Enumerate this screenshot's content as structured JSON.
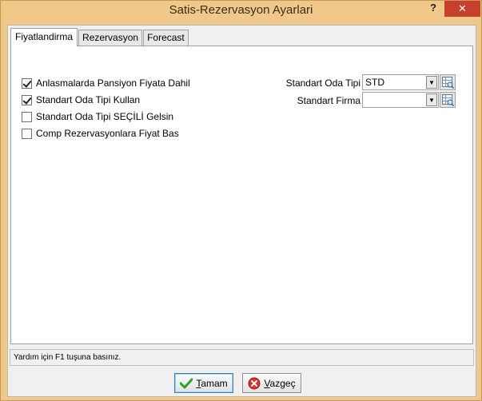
{
  "window": {
    "title": "Satis-Rezervasyon Ayarlari",
    "help_glyph": "?",
    "close_glyph": "✕"
  },
  "tabs": [
    {
      "label": "Fiyatlandirma",
      "active": true
    },
    {
      "label": "Rezervasyon",
      "active": false
    },
    {
      "label": "Forecast",
      "active": false
    }
  ],
  "checkboxes": [
    {
      "label": "Anlasmalarda Pansiyon Fiyata Dahil",
      "checked": true
    },
    {
      "label": "Standart Oda Tipi Kullan",
      "checked": true
    },
    {
      "label": "Standart Oda Tipi SEÇİLİ Gelsin",
      "checked": false
    },
    {
      "label": "Comp Rezervasyonlara Fiyat Bas",
      "checked": false
    }
  ],
  "fields": [
    {
      "label": "Standart Oda Tipi",
      "value": "STD"
    },
    {
      "label": "Standart Firma",
      "value": ""
    }
  ],
  "statusbar": {
    "text": "Yardım için F1 tuşuna basınız."
  },
  "buttons": {
    "ok": {
      "first": "T",
      "rest": "amam"
    },
    "cancel": {
      "first": "V",
      "rest": "azgeç"
    }
  },
  "icons": {
    "ok": "green-check-icon",
    "cancel": "red-x-circle-icon",
    "lookup": "lookup-grid-icon"
  }
}
